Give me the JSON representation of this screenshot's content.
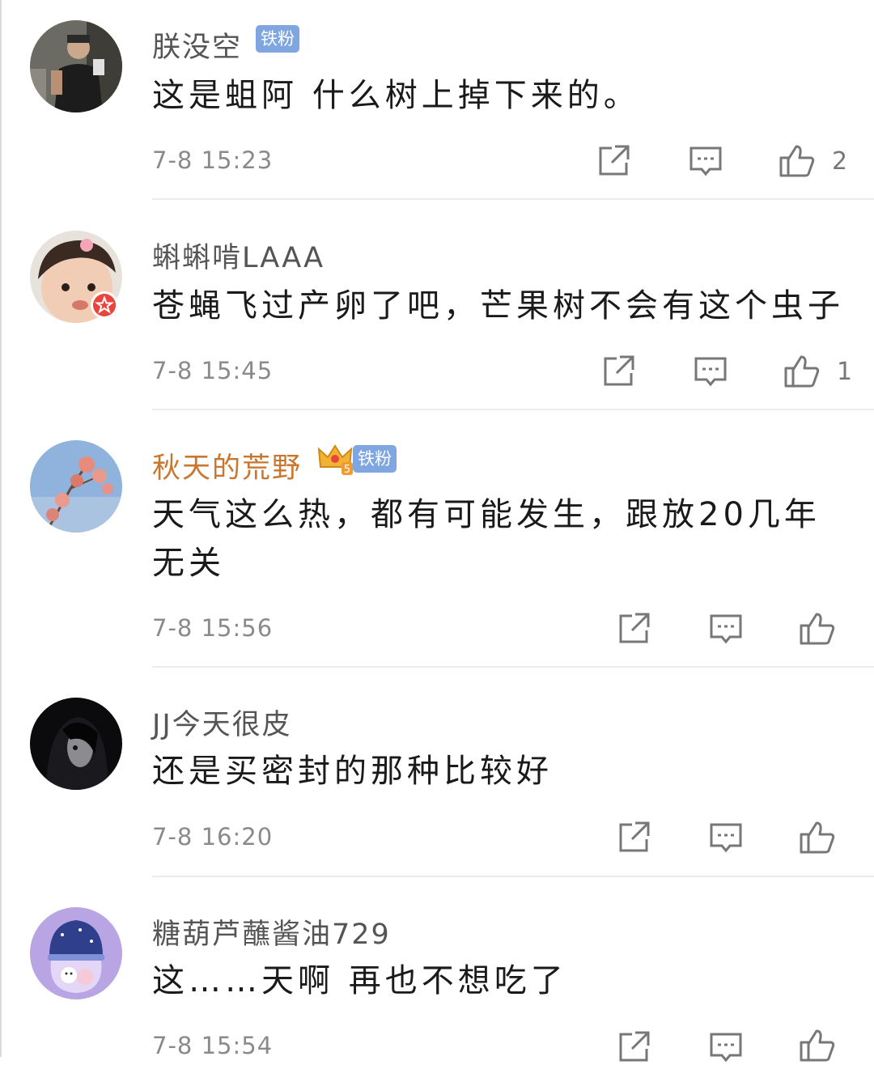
{
  "comments": [
    {
      "username": "朕没空",
      "badge": "铁粉",
      "content": "这是蛆阿 什么树上掉下来的。",
      "time": "7-8 15:23",
      "like_count": "2",
      "avatar_icon": "man-mirror-selfie-avatar"
    },
    {
      "username": "蝌蝌啃LAAA",
      "badge": "",
      "content": "苍蝇飞过产卵了吧，芒果树不会有这个虫子",
      "time": "7-8 15:45",
      "like_count": "1",
      "avatar_icon": "baby-photo-avatar",
      "avatar_badge_color": "#e8453c"
    },
    {
      "username": "秋天的荒野",
      "badge": "铁粉",
      "crown_level": "5",
      "content": "天气这么热，都有可能发生，跟放20几年无关",
      "time": "7-8 15:56",
      "like_count": "",
      "avatar_icon": "blossom-tree-sky-avatar"
    },
    {
      "username": "JJ今天很皮",
      "badge": "",
      "content": "还是买密封的那种比较好",
      "time": "7-8 16:20",
      "like_count": "",
      "avatar_icon": "dark-portrait-avatar"
    },
    {
      "username": "糖葫芦蘸酱油729",
      "badge": "",
      "content": "这……天啊 再也不想吃了",
      "time": "7-8 15:54",
      "like_count": "",
      "avatar_icon": "cartoon-bottle-avatar"
    }
  ],
  "colors": {
    "badge_blue": "#7fa6e0",
    "gold_name": "#c9762e",
    "icon_gray": "#777777"
  }
}
